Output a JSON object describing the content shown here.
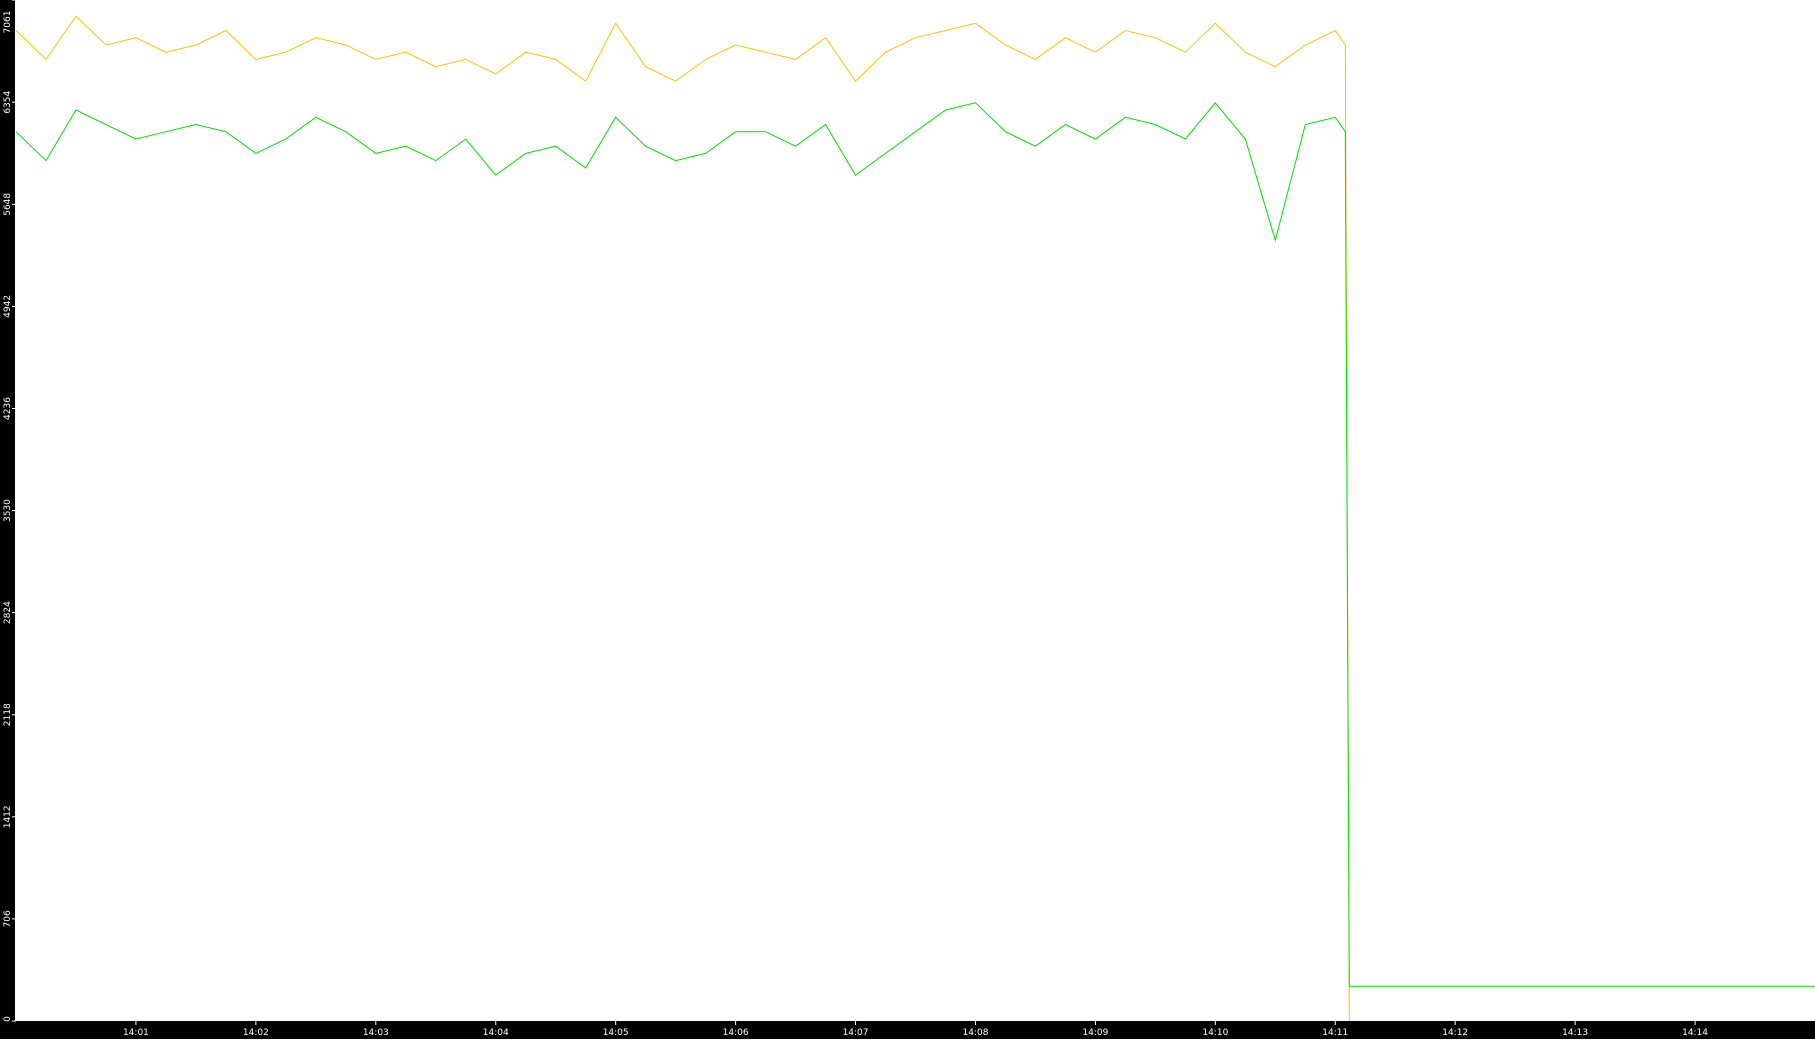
{
  "chart_data": {
    "type": "line",
    "title": "",
    "xlabel": "",
    "ylabel": "",
    "ylim": [
      0,
      7061
    ],
    "xlim": [
      "14:00:00",
      "14:15:00"
    ],
    "x_ticks": [
      "14:01",
      "14:02",
      "14:03",
      "14:04",
      "14:05",
      "14:06",
      "14:07",
      "14:08",
      "14:09",
      "14:10",
      "14:11",
      "14:12",
      "14:13",
      "14:14"
    ],
    "y_ticks": [
      "0",
      "706",
      "1412",
      "2118",
      "2824",
      "3530",
      "4236",
      "4942",
      "5648",
      "6354",
      "7061"
    ],
    "grid": false,
    "legend": "none",
    "series": [
      {
        "color": "#ffc000",
        "x": [
          "14:00:00",
          "14:00:15",
          "14:00:30",
          "14:00:45",
          "14:01:00",
          "14:01:15",
          "14:01:30",
          "14:01:45",
          "14:02:00",
          "14:02:15",
          "14:02:30",
          "14:02:45",
          "14:03:00",
          "14:03:15",
          "14:03:30",
          "14:03:45",
          "14:04:00",
          "14:04:15",
          "14:04:30",
          "14:04:45",
          "14:05:00",
          "14:05:15",
          "14:05:30",
          "14:05:45",
          "14:06:00",
          "14:06:15",
          "14:06:30",
          "14:06:45",
          "14:07:00",
          "14:07:15",
          "14:07:30",
          "14:07:45",
          "14:08:00",
          "14:08:15",
          "14:08:30",
          "14:08:45",
          "14:09:00",
          "14:09:15",
          "14:09:30",
          "14:09:45",
          "14:10:00",
          "14:10:15",
          "14:10:30",
          "14:10:45",
          "14:11:00",
          "14:11:05",
          "14:11:07"
        ],
        "y": [
          6850,
          6650,
          6950,
          6750,
          6800,
          6700,
          6750,
          6850,
          6650,
          6700,
          6800,
          6750,
          6650,
          6700,
          6600,
          6650,
          6550,
          6700,
          6650,
          6500,
          6900,
          6600,
          6500,
          6650,
          6750,
          6700,
          6650,
          6800,
          6500,
          6700,
          6800,
          6850,
          6900,
          6750,
          6650,
          6800,
          6700,
          6850,
          6800,
          6700,
          6900,
          6700,
          6600,
          6750,
          6850,
          6750,
          0
        ]
      },
      {
        "color": "#00e000",
        "x": [
          "14:00:00",
          "14:00:15",
          "14:00:30",
          "14:00:45",
          "14:01:00",
          "14:01:15",
          "14:01:30",
          "14:01:45",
          "14:02:00",
          "14:02:15",
          "14:02:30",
          "14:02:45",
          "14:03:00",
          "14:03:15",
          "14:03:30",
          "14:03:45",
          "14:04:00",
          "14:04:15",
          "14:04:30",
          "14:04:45",
          "14:05:00",
          "14:05:15",
          "14:05:30",
          "14:05:45",
          "14:06:00",
          "14:06:15",
          "14:06:30",
          "14:06:45",
          "14:07:00",
          "14:07:15",
          "14:07:30",
          "14:07:45",
          "14:08:00",
          "14:08:15",
          "14:08:30",
          "14:08:45",
          "14:09:00",
          "14:09:15",
          "14:09:30",
          "14:09:45",
          "14:10:00",
          "14:10:15",
          "14:10:30",
          "14:10:45",
          "14:11:00",
          "14:11:05",
          "14:11:06",
          "14:11:07",
          "14:15:00"
        ],
        "y": [
          6150,
          5950,
          6300,
          6200,
          6100,
          6150,
          6200,
          6150,
          6000,
          6100,
          6250,
          6150,
          6000,
          6050,
          5950,
          6100,
          5850,
          6000,
          6050,
          5900,
          6250,
          6050,
          5950,
          6000,
          6150,
          6150,
          6050,
          6200,
          5850,
          6000,
          6150,
          6300,
          6350,
          6150,
          6050,
          6200,
          6100,
          6250,
          6200,
          6100,
          6350,
          6100,
          5400,
          6200,
          6250,
          6150,
          3150,
          240,
          240
        ]
      }
    ]
  }
}
